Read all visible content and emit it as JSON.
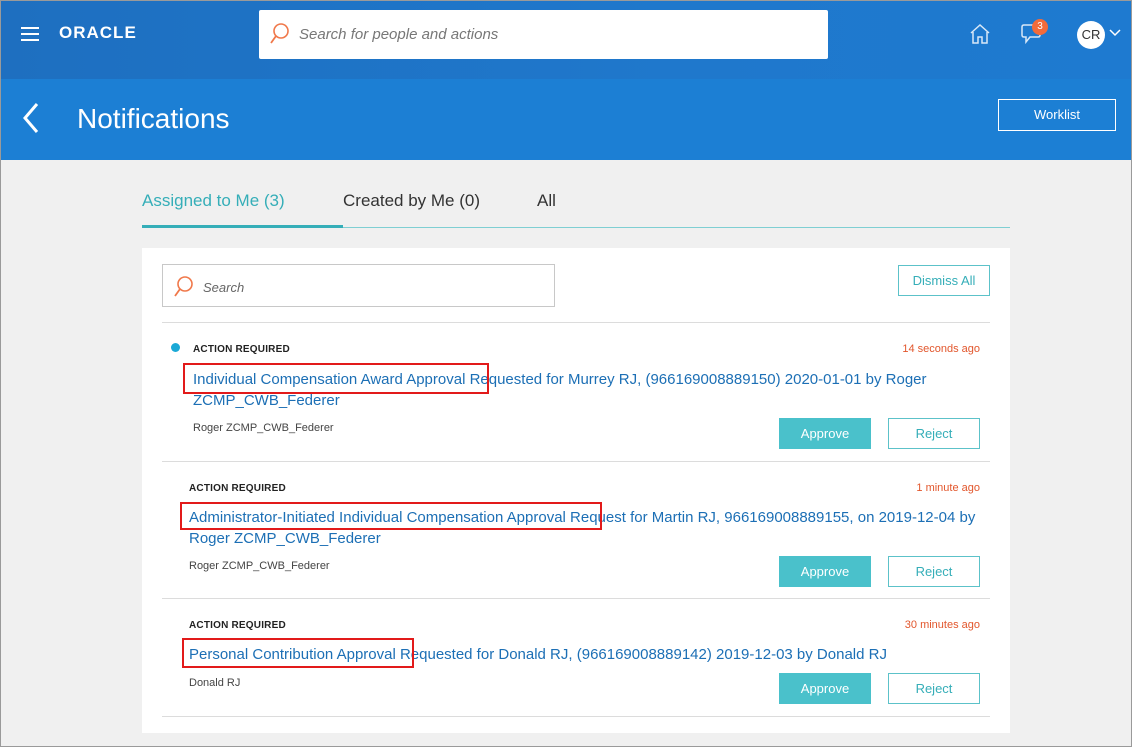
{
  "app": {
    "brand": "ORACLE",
    "search_placeholder": "Search for people and actions",
    "notification_count": "3",
    "user_initials": "CR"
  },
  "header": {
    "title": "Notifications",
    "worklist_label": "Worklist"
  },
  "tabs": [
    {
      "label": "Assigned to Me (3)",
      "active": true
    },
    {
      "label": "Created by Me (0)",
      "active": false
    },
    {
      "label": "All",
      "active": false
    }
  ],
  "panel": {
    "search_placeholder": "Search",
    "dismiss_all_label": "Dismiss All"
  },
  "notifications": [
    {
      "status": "ACTION REQUIRED",
      "time": "14 seconds ago",
      "title_part1": "Individual Compensation Award Approval",
      "title_part2": " Requested for Murrey RJ, (966169008889150) 2020-01-01 by Roger ZCMP_CWB_Federer",
      "sender": "Roger ZCMP_CWB_Federer",
      "approve_label": "Approve",
      "reject_label": "Reject",
      "unread": true
    },
    {
      "status": "ACTION REQUIRED",
      "time": "1 minute ago",
      "title_part1": "Administrator-Initiated Individual Compensation Approval",
      "title_part2": " Request for Martin RJ, 966169008889155, on 2019-12-04 by Roger ZCMP_CWB_Federer",
      "sender": "Roger ZCMP_CWB_Federer",
      "approve_label": "Approve",
      "reject_label": "Reject",
      "unread": false
    },
    {
      "status": "ACTION REQUIRED",
      "time": "30 minutes ago",
      "title_part1": "Personal Contribution Approval",
      "title_part2": " Requested for Donald RJ, (966169008889142) 2019-12-03 by Donald RJ",
      "sender": "Donald RJ",
      "approve_label": "Approve",
      "reject_label": "Reject",
      "unread": false
    }
  ],
  "colors": {
    "topbar": "#1e6fc0",
    "header": "#1c7fd4",
    "accent": "#35aeb8",
    "link": "#1c6fb5",
    "timestamp": "#e2562c",
    "highlight": "#e21a1a"
  },
  "icons": [
    "hamburger-menu-icon",
    "search-icon",
    "home-icon",
    "notifications-bell-icon",
    "chevron-down-icon",
    "back-chevron-icon"
  ]
}
